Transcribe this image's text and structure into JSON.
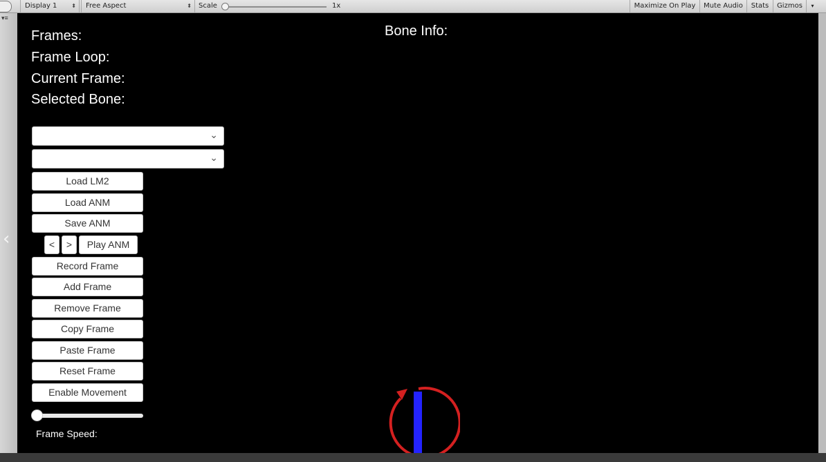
{
  "toolbar": {
    "display": "Display 1",
    "aspect": "Free Aspect",
    "scale_label": "Scale",
    "scale_value_text": "1x",
    "scale_value": 1,
    "maximize": "Maximize On Play",
    "mute": "Mute Audio",
    "stats": "Stats",
    "gizmos": "Gizmos"
  },
  "info": {
    "frames": "Frames:",
    "frame_loop": "Frame Loop:",
    "current_frame": "Current Frame:",
    "selected_bone": "Selected Bone:",
    "bone_info": "Bone Info:"
  },
  "dropdowns": [
    {
      "value": ""
    },
    {
      "value": ""
    }
  ],
  "buttons": {
    "load_lm2": "Load LM2",
    "load_anm": "Load ANM",
    "save_anm": "Save ANM",
    "prev": "<",
    "next": ">",
    "play_anm": "Play ANM",
    "record_frame": "Record Frame",
    "add_frame": "Add Frame",
    "remove_frame": "Remove Frame",
    "copy_frame": "Copy Frame",
    "paste_frame": "Paste Frame",
    "reset_frame": "Reset Frame",
    "enable_movement": "Enable Movement"
  },
  "frame_speed": {
    "label": "Frame Speed:",
    "value": 0
  },
  "colors": {
    "viewport": "#000000",
    "gizmo_ring": "#d42020",
    "gizmo_axis": "#2323ff"
  }
}
